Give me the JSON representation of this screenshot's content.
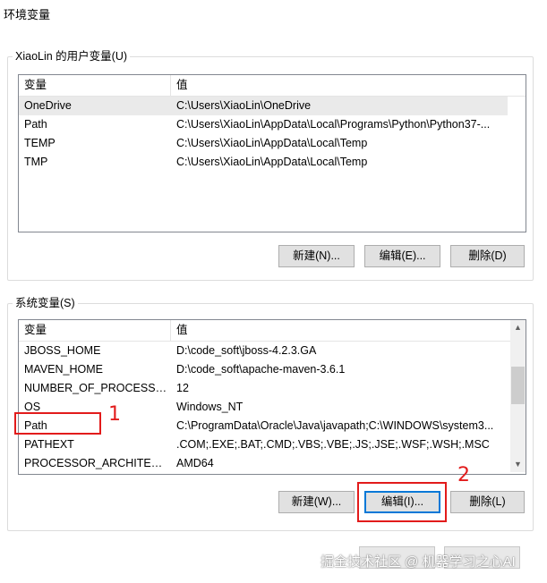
{
  "window": {
    "title": "环境变量"
  },
  "user_vars": {
    "group_label": "XiaoLin 的用户变量(U)",
    "columns": [
      "变量",
      "值"
    ],
    "rows": [
      {
        "name": "OneDrive",
        "value": "C:\\Users\\XiaoLin\\OneDrive"
      },
      {
        "name": "Path",
        "value": "C:\\Users\\XiaoLin\\AppData\\Local\\Programs\\Python\\Python37-..."
      },
      {
        "name": "TEMP",
        "value": "C:\\Users\\XiaoLin\\AppData\\Local\\Temp"
      },
      {
        "name": "TMP",
        "value": "C:\\Users\\XiaoLin\\AppData\\Local\\Temp"
      }
    ],
    "buttons": {
      "new": "新建(N)...",
      "edit": "编辑(E)...",
      "delete": "删除(D)"
    }
  },
  "system_vars": {
    "group_label": "系统变量(S)",
    "columns": [
      "变量",
      "值"
    ],
    "rows": [
      {
        "name": "JBOSS_HOME",
        "value": "D:\\code_soft\\jboss-4.2.3.GA"
      },
      {
        "name": "MAVEN_HOME",
        "value": "D:\\code_soft\\apache-maven-3.6.1"
      },
      {
        "name": "NUMBER_OF_PROCESSORS",
        "value": "12"
      },
      {
        "name": "OS",
        "value": "Windows_NT"
      },
      {
        "name": "Path",
        "value": "C:\\ProgramData\\Oracle\\Java\\javapath;C:\\WINDOWS\\system3..."
      },
      {
        "name": "PATHEXT",
        "value": ".COM;.EXE;.BAT;.CMD;.VBS;.VBE;.JS;.JSE;.WSF;.WSH;.MSC"
      },
      {
        "name": "PROCESSOR_ARCHITECT...",
        "value": "AMD64"
      }
    ],
    "buttons": {
      "new": "新建(W)...",
      "edit": "编辑(I)...",
      "delete": "删除(L)"
    }
  },
  "annotations": {
    "step1": "1",
    "step2": "2"
  },
  "watermark": "掘金技术社区 @ 机器学习之心AI",
  "colors": {
    "annotation_red": "#e21b1b",
    "focus_blue": "#0078d7",
    "selected_row": "#eaeaea"
  }
}
